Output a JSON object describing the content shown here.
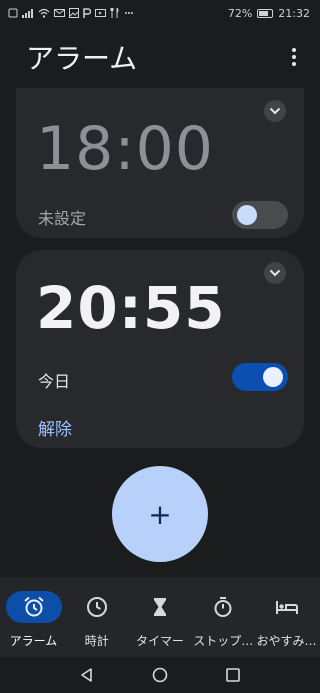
{
  "status_bar": {
    "left_icons": [
      "sim-icon",
      "signal-icon",
      "wifi-icon",
      "mail-icon",
      "photo-icon",
      "p-icon",
      "video-icon",
      "food-icon",
      "more-icon"
    ],
    "battery_percent": "72%",
    "time": "21:32"
  },
  "app_bar": {
    "title": "アラーム"
  },
  "alarms": [
    {
      "time": "18:00",
      "day": "未設定",
      "enabled": false
    },
    {
      "time": "20:55",
      "day": "今日",
      "enabled": true,
      "dismiss_label": "解除"
    }
  ],
  "fab": {
    "symbol": "+"
  },
  "bottom_nav": {
    "items": [
      {
        "label": "アラーム",
        "icon": "alarm-icon",
        "active": true
      },
      {
        "label": "時計",
        "icon": "clock-icon",
        "active": false
      },
      {
        "label": "タイマー",
        "icon": "hourglass-icon",
        "active": false
      },
      {
        "label": "ストップ…",
        "icon": "stopwatch-icon",
        "active": false
      },
      {
        "label": "おやすみ…",
        "icon": "bed-icon",
        "active": false
      }
    ]
  },
  "colors": {
    "background": "#1b1c1e",
    "card": "#28292c",
    "accent": "#0b4fb3",
    "fab": "#b8d1fb",
    "dismiss": "#9cc0ff"
  }
}
